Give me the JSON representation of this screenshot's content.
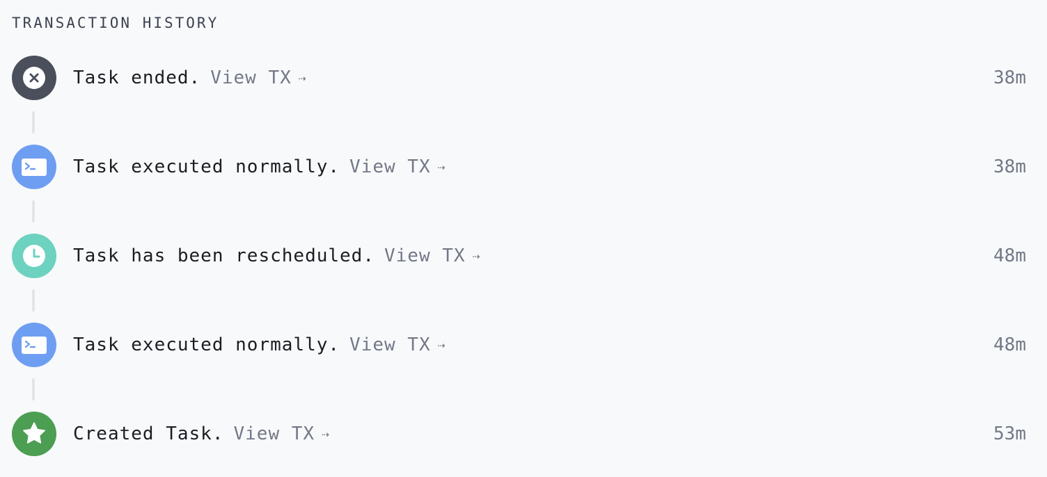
{
  "header": {
    "title": "TRANSACTION HISTORY"
  },
  "events": [
    {
      "message": "Task ended.",
      "link_label": "View TX",
      "arrow": "⇢",
      "time": "38m",
      "icon": "close-icon",
      "icon_color": "#4a4f5b"
    },
    {
      "message": "Task executed normally.",
      "link_label": "View TX",
      "arrow": "⇢",
      "time": "38m",
      "icon": "terminal-icon",
      "icon_color": "#6e9ef2"
    },
    {
      "message": "Task has been rescheduled.",
      "link_label": "View TX",
      "arrow": "⇢",
      "time": "48m",
      "icon": "clock-icon",
      "icon_color": "#6dd2c0"
    },
    {
      "message": "Task executed normally.",
      "link_label": "View TX",
      "arrow": "⇢",
      "time": "48m",
      "icon": "terminal-icon",
      "icon_color": "#6e9ef2"
    },
    {
      "message": "Created Task.",
      "link_label": "View TX",
      "arrow": "⇢",
      "time": "53m",
      "icon": "star-icon",
      "icon_color": "#4c9e52"
    }
  ]
}
